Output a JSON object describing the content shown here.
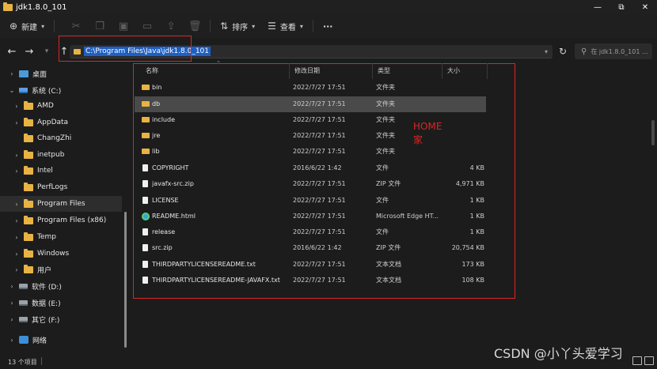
{
  "window": {
    "title": "jdk1.8.0_101",
    "minimize_glyph": "—",
    "maximize_glyph": "⧉",
    "close_glyph": "✕"
  },
  "toolbar": {
    "new_label": "新建",
    "sort_label": "排序",
    "view_label": "查看",
    "more_label": "···"
  },
  "address": {
    "path": "C:\\Program Files\\Java\\jdk1.8.0_101",
    "search_placeholder": "在 jdk1.8.0_101 ..."
  },
  "nav": {
    "items": [
      {
        "label": "桌面"
      },
      {
        "label": "系统 (C:)"
      },
      {
        "label": "AMD"
      },
      {
        "label": "AppData"
      },
      {
        "label": "ChangZhi"
      },
      {
        "label": "inetpub"
      },
      {
        "label": "Intel"
      },
      {
        "label": "PerfLogs"
      },
      {
        "label": "Program Files"
      },
      {
        "label": "Program Files (x86)"
      },
      {
        "label": "Temp"
      },
      {
        "label": "Windows"
      },
      {
        "label": "用户"
      },
      {
        "label": "软件 (D:)"
      },
      {
        "label": "数据 (E:)"
      },
      {
        "label": "其它 (F:)"
      },
      {
        "label": "网络"
      }
    ]
  },
  "columns": {
    "name": "名称",
    "date": "修改日期",
    "type": "类型",
    "size": "大小"
  },
  "files": [
    {
      "name": "bin",
      "date": "2022/7/27 17:51",
      "type": "文件夹",
      "size": ""
    },
    {
      "name": "db",
      "date": "2022/7/27 17:51",
      "type": "文件夹",
      "size": ""
    },
    {
      "name": "include",
      "date": "2022/7/27 17:51",
      "type": "文件夹",
      "size": ""
    },
    {
      "name": "jre",
      "date": "2022/7/27 17:51",
      "type": "文件夹",
      "size": ""
    },
    {
      "name": "lib",
      "date": "2022/7/27 17:51",
      "type": "文件夹",
      "size": ""
    },
    {
      "name": "COPYRIGHT",
      "date": "2016/6/22 1:42",
      "type": "文件",
      "size": "4 KB"
    },
    {
      "name": "javafx-src.zip",
      "date": "2022/7/27 17:51",
      "type": "ZIP 文件",
      "size": "4,971 KB"
    },
    {
      "name": "LICENSE",
      "date": "2022/7/27 17:51",
      "type": "文件",
      "size": "1 KB"
    },
    {
      "name": "README.html",
      "date": "2022/7/27 17:51",
      "type": "Microsoft Edge HT...",
      "size": "1 KB"
    },
    {
      "name": "release",
      "date": "2022/7/27 17:51",
      "type": "文件",
      "size": "1 KB"
    },
    {
      "name": "src.zip",
      "date": "2016/6/22 1:42",
      "type": "ZIP 文件",
      "size": "20,754 KB"
    },
    {
      "name": "THIRDPARTYLICENSEREADME.txt",
      "date": "2022/7/27 17:51",
      "type": "文本文档",
      "size": "173 KB"
    },
    {
      "name": "THIRDPARTYLICENSEREADME-JAVAFX.txt",
      "date": "2022/7/27 17:51",
      "type": "文本文档",
      "size": "108 KB"
    }
  ],
  "annotation": {
    "line1": "HOME",
    "line2": "家"
  },
  "status": {
    "count": "13 个项目"
  },
  "watermark": "CSDN @小丫头爱学习"
}
